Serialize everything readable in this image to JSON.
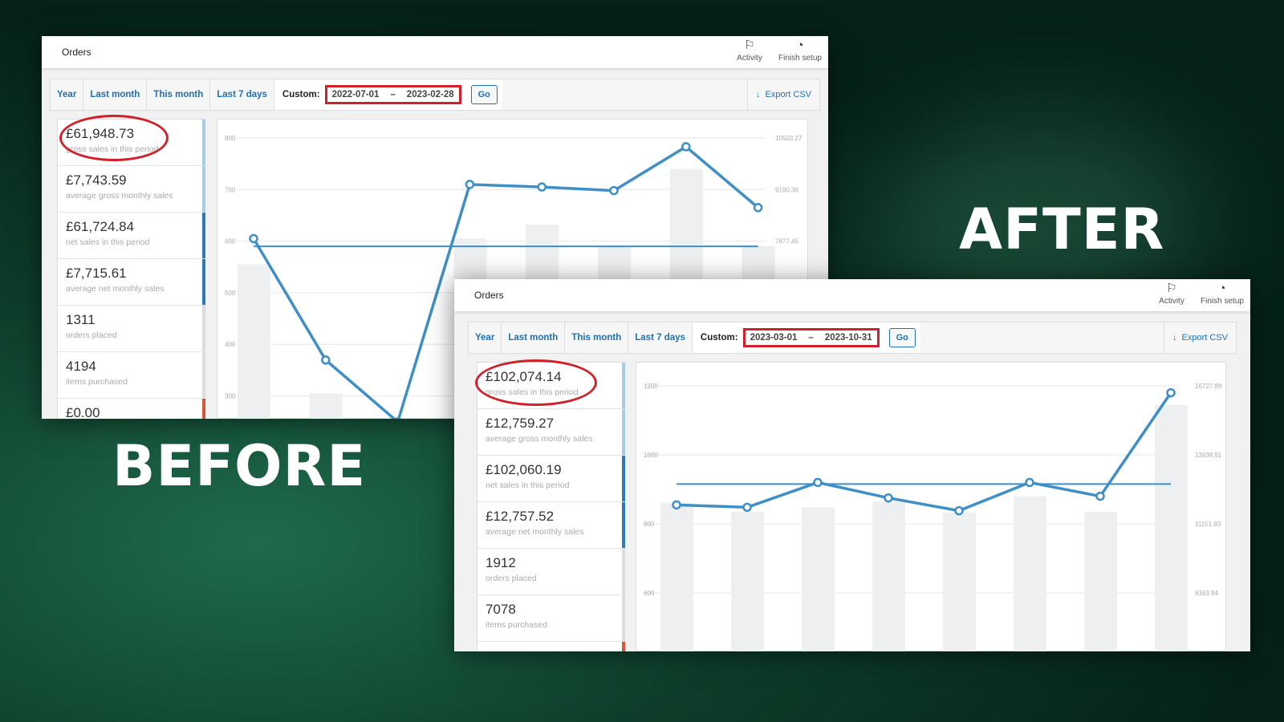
{
  "labels": {
    "after": "AFTER",
    "before": "BEFORE"
  },
  "colors": {
    "accent": "#2271b1",
    "line": "#3d8fc6",
    "highlight": "#d0212a",
    "bar": "#edeff0"
  },
  "windows": [
    {
      "id": "before",
      "title": "Orders",
      "header_buttons": [
        {
          "label": "Activity",
          "icon": "flag-icon"
        },
        {
          "label": "Finish setup",
          "icon": "progress-circle-icon"
        }
      ],
      "tabs": [
        "Year",
        "Last month",
        "This month",
        "Last 7 days"
      ],
      "custom_label": "Custom:",
      "date_from": "2022-07-01",
      "date_sep": "–",
      "date_to": "2023-02-28",
      "go_label": "Go",
      "export_label": "Export CSV",
      "stats": [
        {
          "value": "£61,948.73",
          "label": "gross sales in this period",
          "color": "#a8cce6"
        },
        {
          "value": "£7,743.59",
          "label": "average gross monthly sales",
          "color": "#a8cce6"
        },
        {
          "value": "£61,724.84",
          "label": "net sales in this period",
          "color": "#2e7ab8"
        },
        {
          "value": "£7,715.61",
          "label": "average net monthly sales",
          "color": "#2e7ab8"
        },
        {
          "value": "1311",
          "label": "orders placed",
          "color": "#dcdcdc"
        },
        {
          "value": "4194",
          "label": "items purchased",
          "color": "#dcdcdc"
        },
        {
          "value": "£0.00",
          "label": "",
          "color": "#d9533b"
        }
      ],
      "chart_data": {
        "type": "bar+line",
        "left_ticks": [
          800,
          700,
          600,
          500,
          400,
          300
        ],
        "right_ticks": [
          "10503.27",
          "9190.36",
          "7877.45"
        ],
        "ylim_left": [
          300,
          800
        ],
        "bars_orders": [
          555,
          305,
          200,
          605,
          632,
          590,
          740,
          590
        ],
        "line_sales": [
          7943,
          4852,
          3277,
          9321,
          9256,
          9164,
          10280,
          8731
        ],
        "average_line": 7743.59
      }
    },
    {
      "id": "after",
      "title": "Orders",
      "header_buttons": [
        {
          "label": "Activity",
          "icon": "flag-icon"
        },
        {
          "label": "Finish setup",
          "icon": "progress-circle-icon"
        }
      ],
      "tabs": [
        "Year",
        "Last month",
        "This month",
        "Last 7 days"
      ],
      "custom_label": "Custom:",
      "date_from": "2023-03-01",
      "date_sep": "–",
      "date_to": "2023-10-31",
      "go_label": "Go",
      "export_label": "Export CSV",
      "stats": [
        {
          "value": "£102,074.14",
          "label": "gross sales in this period",
          "color": "#a8cce6"
        },
        {
          "value": "£12,759.27",
          "label": "average gross monthly sales",
          "color": "#a8cce6"
        },
        {
          "value": "£102,060.19",
          "label": "net sales in this period",
          "color": "#2e7ab8"
        },
        {
          "value": "£12,757.52",
          "label": "average net monthly sales",
          "color": "#2e7ab8"
        },
        {
          "value": "1912",
          "label": "orders placed",
          "color": "#dcdcdc"
        },
        {
          "value": "7078",
          "label": "items purchased",
          "color": "#dcdcdc"
        },
        {
          "value": "",
          "label": "",
          "color": "#d9533b"
        }
      ],
      "chart_data": {
        "type": "bar+line",
        "left_ticks": [
          1200,
          1000,
          800,
          600
        ],
        "right_ticks": [
          "16727.89",
          "13939.91",
          "11151.93",
          "8363.94"
        ],
        "ylim_left": [
          600,
          1200
        ],
        "bars_orders": [
          860,
          835,
          848,
          865,
          833,
          880,
          835,
          1145
        ],
        "line_sales": [
          11919,
          11821,
          12825,
          12199,
          11682,
          12825,
          12267,
          16449
        ],
        "average_line": 12759.27
      }
    }
  ]
}
